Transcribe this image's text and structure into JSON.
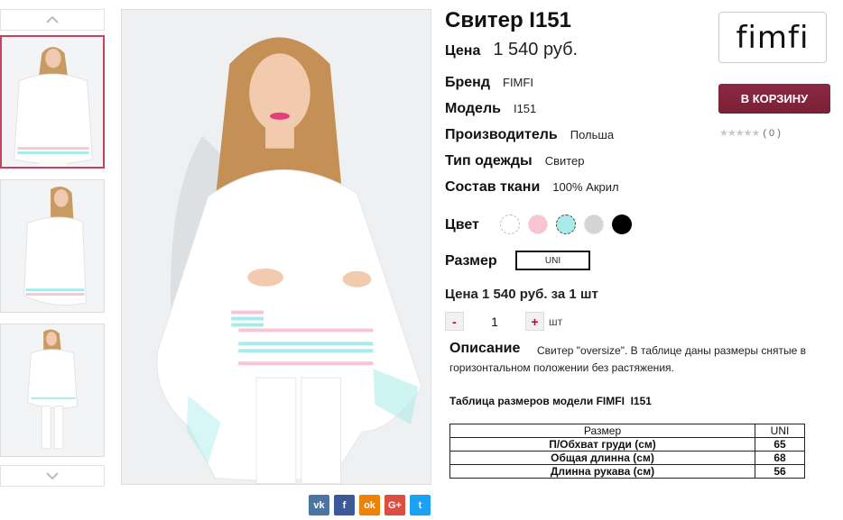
{
  "product": {
    "title": "Свитер I151",
    "price_label": "Цена",
    "price": "1 540 руб.",
    "attributes": [
      {
        "label": "Бренд",
        "value": "FIMFI"
      },
      {
        "label": "Модель",
        "value": "I151"
      },
      {
        "label": "Производитель",
        "value": "Польша"
      },
      {
        "label": "Тип одежды",
        "value": "Свитер"
      },
      {
        "label": "Состав ткани",
        "value": "100% Акрил"
      }
    ],
    "color_label": "Цвет",
    "colors": [
      "#ffffff",
      "#f7c6d2",
      "#a7ecea",
      "#d4d4d4",
      "#000000"
    ],
    "selected_color": "#a7ecea",
    "size_label": "Размер",
    "size_value": "UNI",
    "price_per_unit": "Цена 1 540 руб. за 1 шт",
    "quantity": {
      "minus": "-",
      "value": "1",
      "plus": "+",
      "unit": "шт"
    },
    "description_label": "Описание",
    "description": "Свитер \"oversize\". В таблице даны размеры снятые в горизонтальном положении без растяжения."
  },
  "size_table": {
    "title": "Таблица размеров модели FIMFI  I151",
    "headers": [
      "Размер",
      "UNI"
    ],
    "rows": [
      [
        "П/Обхват груди (см)",
        "65"
      ],
      [
        "Общая длинна (см)",
        "68"
      ],
      [
        "Длинна рукава (см)",
        "56"
      ]
    ]
  },
  "sidebar": {
    "logo": "fimfi",
    "cart_button": "В КОРЗИНУ",
    "stars": "★★★★★",
    "rating_count": "( 0 )"
  },
  "share": {
    "icons": [
      "vk-icon",
      "facebook-icon",
      "odnoklassniki-icon",
      "google-plus-icon",
      "twitter-icon"
    ],
    "labels": [
      "vk",
      "f",
      "ok",
      "G+",
      "t"
    ]
  },
  "gallery": {
    "thumbnail_count": 3,
    "active_index": 0
  },
  "theme": {
    "accent": "#7a2035",
    "thumb_active_border": "#c9415f"
  }
}
